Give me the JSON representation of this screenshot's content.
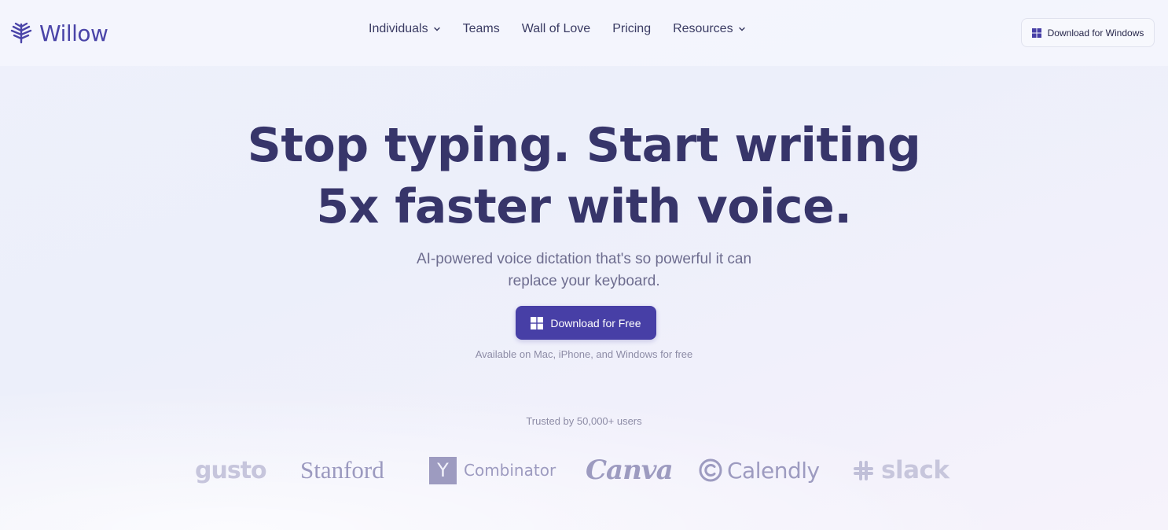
{
  "header": {
    "logo_text": "Willow",
    "nav": [
      {
        "label": "Individuals",
        "has_dropdown": true
      },
      {
        "label": "Teams",
        "has_dropdown": false
      },
      {
        "label": "Wall of Love",
        "has_dropdown": false
      },
      {
        "label": "Pricing",
        "has_dropdown": false
      },
      {
        "label": "Resources",
        "has_dropdown": true
      }
    ],
    "download_button": "Download for Windows"
  },
  "hero": {
    "title_line1": "Stop typing. Start writing",
    "title_line2": "5x faster with voice.",
    "subtitle_line1": "AI-powered voice dictation that's so powerful it can",
    "subtitle_line2": "replace your keyboard.",
    "cta_label": "Download for Free",
    "availability": "Available on Mac, iPhone, and Windows for free"
  },
  "trusted": {
    "label": "Trusted by 50,000+ users",
    "logos": {
      "gusto": "gusto",
      "stanford": "Stanford",
      "yc_letter": "Y",
      "yc_text": "Combinator",
      "canva": "Canva",
      "calendly": "Calendly",
      "slack": "slack"
    }
  },
  "colors": {
    "brand": "#473fa6",
    "title": "#37356a",
    "logo_gray": "#9d9bc0"
  }
}
